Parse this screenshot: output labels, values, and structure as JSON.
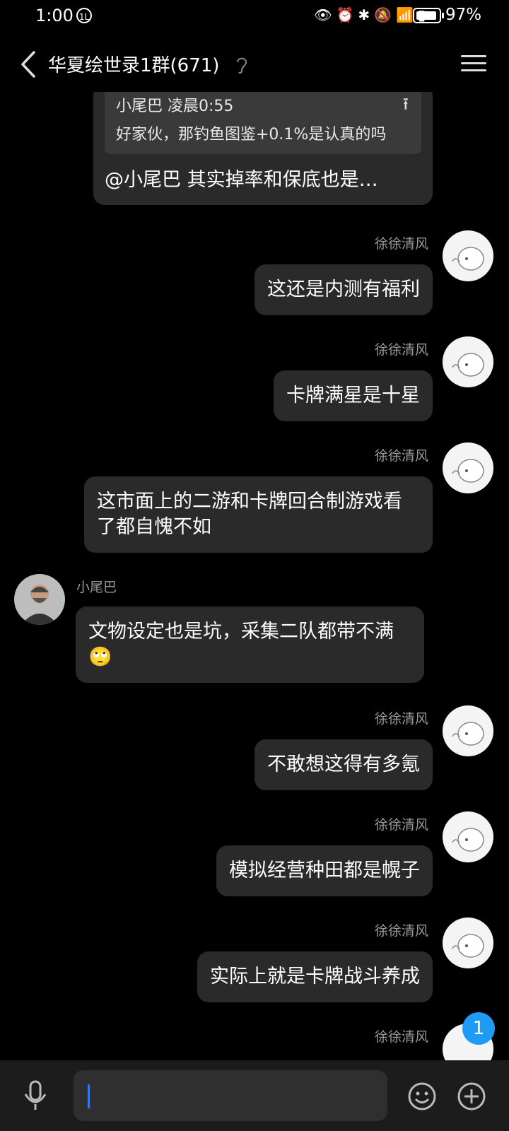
{
  "status_bar": {
    "time": "1:00",
    "badge": "1L",
    "battery": "97%"
  },
  "header": {
    "title": "华夏绘世录1群(671)"
  },
  "quoted_message": {
    "sender": "小尾巴 凌晨0:55",
    "text": "好家伙，那钓鱼图鉴+0.1%是认真的吗",
    "reply_preview": "@小尾巴 其实掉率和保底也是…"
  },
  "messages": [
    {
      "sender": "徐徐清风",
      "text": "这还是内测有福利"
    },
    {
      "sender": "徐徐清风",
      "text": "卡牌满星是十星"
    },
    {
      "sender": "徐徐清风",
      "text": "这市面上的二游和卡牌回合制游戏看了都自愧不如"
    },
    {
      "sender": "小尾巴",
      "text": "文物设定也是坑，采集二队都带不满"
    },
    {
      "sender": "徐徐清风",
      "text": "不敢想这得有多氪"
    },
    {
      "sender": "徐徐清风",
      "text": "模拟经营种田都是幌子"
    },
    {
      "sender": "徐徐清风",
      "text": "实际上就是卡牌战斗养成"
    },
    {
      "sender": "徐徐清风",
      "text": ""
    }
  ],
  "unread_count": "1",
  "input": {
    "value": ""
  },
  "colors": {
    "background": "#000000",
    "bubble": "#2a2a2a",
    "accent": "#1e9bf5"
  },
  "icons": [
    "back-icon",
    "ear-icon",
    "menu-icon",
    "microphone-icon",
    "emoji-icon",
    "plus-icon"
  ]
}
